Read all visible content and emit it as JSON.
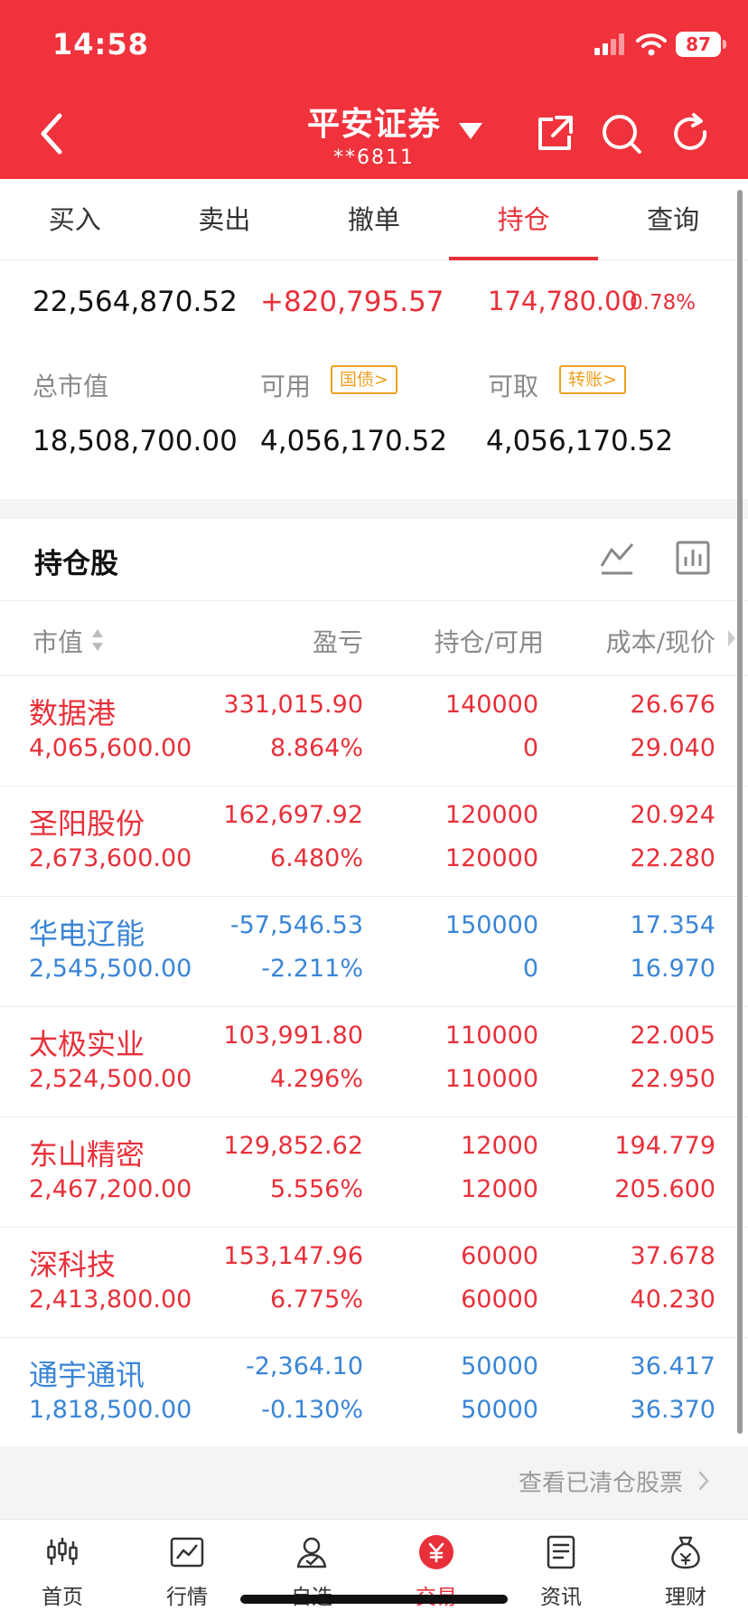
{
  "status_bar": {
    "time": "14:58",
    "battery": "87"
  },
  "header": {
    "title": "平安证券",
    "account": "**6811"
  },
  "tabs": [
    {
      "label": "买入"
    },
    {
      "label": "卖出"
    },
    {
      "label": "撤单"
    },
    {
      "label": "持仓",
      "active": true
    },
    {
      "label": "查询"
    }
  ],
  "summary": {
    "total_assets": "22,564,870.52",
    "profit_loss": "+820,795.57",
    "today_pl": "174,780.00",
    "today_pl_pct": "0.78%",
    "market_value_label": "总市值",
    "market_value": "18,508,700.00",
    "available_label": "可用",
    "available_badge": "国债>",
    "available": "4,056,170.52",
    "withdrawable_label": "可取",
    "withdrawable_badge": "转账>",
    "withdrawable": "4,056,170.52"
  },
  "holdings": {
    "title": "持仓股",
    "columns": {
      "market_value": "市值",
      "profit_loss": "盈亏",
      "position": "持仓/可用",
      "cost_price": "成本/现价"
    },
    "rows": [
      {
        "name": "数据港",
        "market_value": "4,065,600.00",
        "pl": "331,015.90",
        "pl_pct": "8.864%",
        "position": "140000",
        "available": "0",
        "cost": "26.676",
        "price": "29.040",
        "trend": "up"
      },
      {
        "name": "圣阳股份",
        "market_value": "2,673,600.00",
        "pl": "162,697.92",
        "pl_pct": "6.480%",
        "position": "120000",
        "available": "120000",
        "cost": "20.924",
        "price": "22.280",
        "trend": "up"
      },
      {
        "name": "华电辽能",
        "market_value": "2,545,500.00",
        "pl": "-57,546.53",
        "pl_pct": "-2.211%",
        "position": "150000",
        "available": "0",
        "cost": "17.354",
        "price": "16.970",
        "trend": "down"
      },
      {
        "name": "太极实业",
        "market_value": "2,524,500.00",
        "pl": "103,991.80",
        "pl_pct": "4.296%",
        "position": "110000",
        "available": "110000",
        "cost": "22.005",
        "price": "22.950",
        "trend": "up"
      },
      {
        "name": "东山精密",
        "market_value": "2,467,200.00",
        "pl": "129,852.62",
        "pl_pct": "5.556%",
        "position": "12000",
        "available": "12000",
        "cost": "194.779",
        "price": "205.600",
        "trend": "up"
      },
      {
        "name": "深科技",
        "market_value": "2,413,800.00",
        "pl": "153,147.96",
        "pl_pct": "6.775%",
        "position": "60000",
        "available": "60000",
        "cost": "37.678",
        "price": "40.230",
        "trend": "up"
      },
      {
        "name": "通宇通讯",
        "market_value": "1,818,500.00",
        "pl": "-2,364.10",
        "pl_pct": "-0.130%",
        "position": "50000",
        "available": "50000",
        "cost": "36.417",
        "price": "36.370",
        "trend": "down"
      }
    ]
  },
  "cleared_link": "查看已清仓股票",
  "bottom_nav": [
    {
      "label": "首页",
      "icon": "candlestick-icon"
    },
    {
      "label": "行情",
      "icon": "market-chart-icon"
    },
    {
      "label": "自选",
      "icon": "watchlist-person-icon"
    },
    {
      "label": "交易",
      "icon": "yen-trade-icon",
      "active": true
    },
    {
      "label": "资讯",
      "icon": "news-document-icon"
    },
    {
      "label": "理财",
      "icon": "money-bag-icon"
    }
  ],
  "colors": {
    "brand_red": "#f0323c",
    "up_red": "#e8303a",
    "down_blue": "#3a85d6",
    "badge_orange": "#f0a020"
  }
}
